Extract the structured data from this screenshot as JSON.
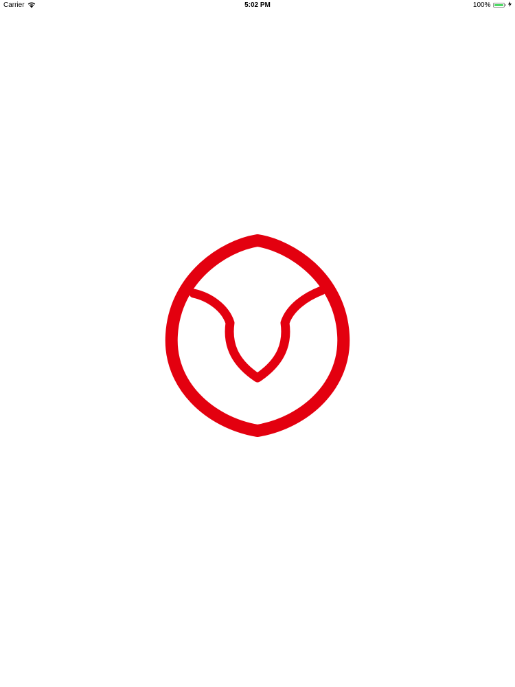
{
  "status_bar": {
    "carrier": "Carrier",
    "time": "5:02 PM",
    "battery_percent_label": "100%",
    "battery_level": 1.0,
    "battery_color": "#4cd964",
    "icons": [
      "wifi-icon",
      "battery-icon",
      "charging-bolt-icon"
    ]
  },
  "splash": {
    "logo_icon": "red-shield-circle-logo-icon",
    "logo_color": "#e3000f"
  }
}
